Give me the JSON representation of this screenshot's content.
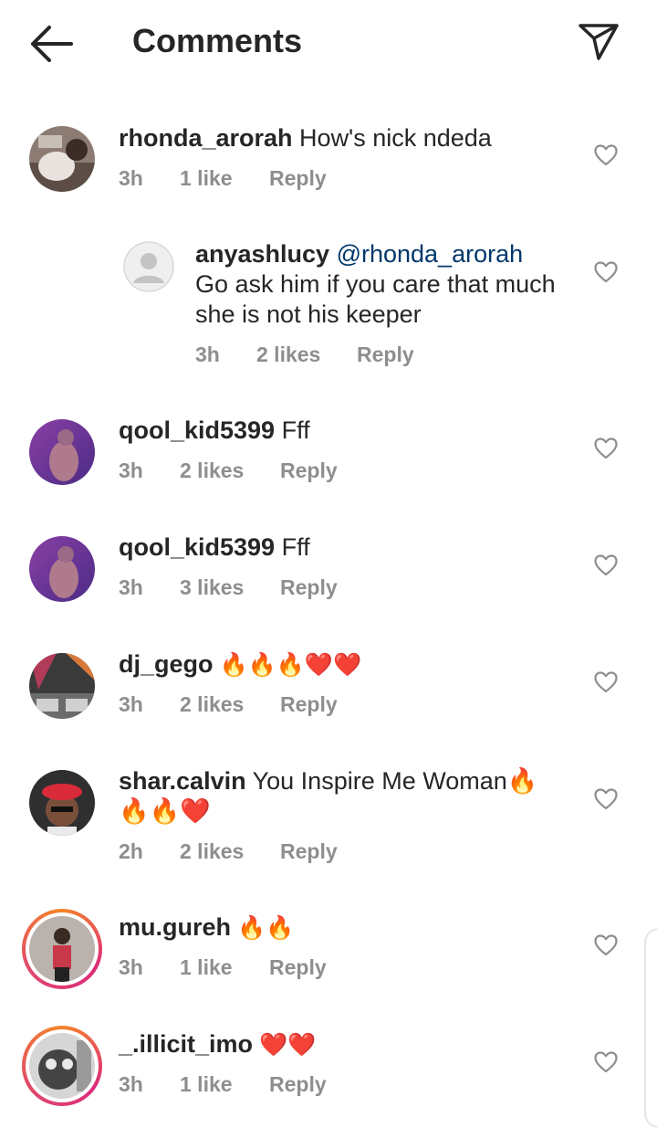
{
  "header": {
    "title": "Comments"
  },
  "comments": [
    {
      "username": "rhonda_arorah",
      "text": " How's nick ndeda",
      "time": "3h",
      "likes": "1 like",
      "reply": "Reply"
    },
    {
      "username": "anyashlucy",
      "mention": " @rhonda_arorah",
      "text": " Go ask him if you care that much she is not his keeper",
      "time": "3h",
      "likes": "2 likes",
      "reply": "Reply"
    },
    {
      "username": "qool_kid5399",
      "text": " Fff",
      "time": "3h",
      "likes": "2 likes",
      "reply": "Reply"
    },
    {
      "username": "qool_kid5399",
      "text": " Fff",
      "time": "3h",
      "likes": "3 likes",
      "reply": "Reply"
    },
    {
      "username": "dj_gego",
      "text": " 🔥🔥🔥❤️❤️",
      "time": "3h",
      "likes": "2 likes",
      "reply": "Reply"
    },
    {
      "username": "shar.calvin",
      "text": " You Inspire Me Woman🔥🔥🔥❤️",
      "time": "2h",
      "likes": "2 likes",
      "reply": "Reply"
    },
    {
      "username": "mu.gureh",
      "text": " 🔥🔥",
      "time": "3h",
      "likes": "1 like",
      "reply": "Reply"
    },
    {
      "username": "_.illicit_imo",
      "text": " ❤️❤️",
      "time": "3h",
      "likes": "1 like",
      "reply": "Reply"
    }
  ],
  "icons": {
    "back": "arrow-left-icon",
    "share": "paper-plane-icon",
    "like": "heart-outline-icon"
  },
  "colors": {
    "text": "#262626",
    "secondary": "#8e8e8e",
    "mention": "#00376b",
    "story_ring_start": "#f58529",
    "story_ring_end": "#dd2a7b"
  }
}
